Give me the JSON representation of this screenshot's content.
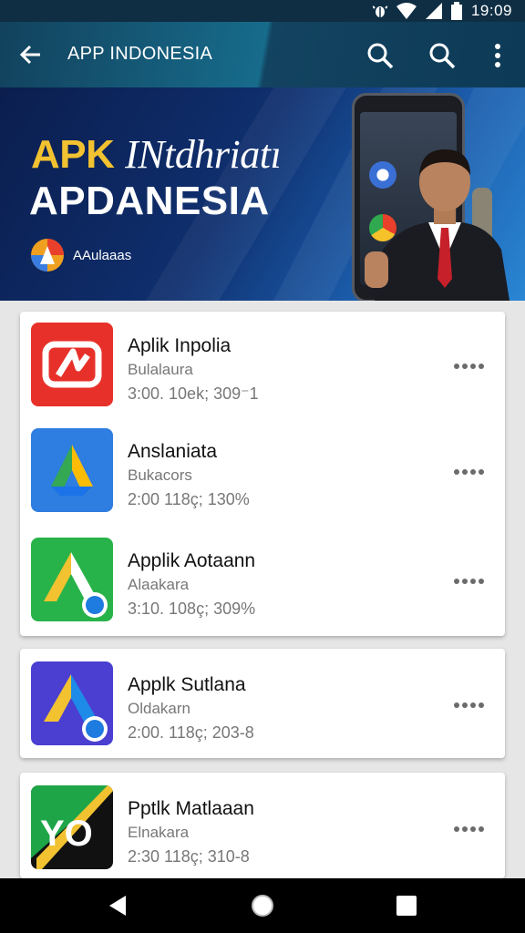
{
  "status_bar": {
    "time": "19:09"
  },
  "app_bar": {
    "title": "APP INDONESIA",
    "back_icon": "arrow-left-icon",
    "search_icon": "search-icon",
    "more_icon": "more-vert-icon"
  },
  "banner": {
    "line1_accent": "APK",
    "line1_rest": "INtdhriatı",
    "line2": "APDANESIA",
    "logo_text": "AAulaaas"
  },
  "apps": [
    {
      "name": "Aplik Inpolia",
      "subtitle": "Bulalaura",
      "meta": "3:00. 10ek; 309⁻1",
      "icon_color": "#e8302a"
    },
    {
      "name": "Anslaniata",
      "subtitle": "Bukacors",
      "meta": "2:00 118ç; 130%",
      "icon_color": "#2e7de0"
    },
    {
      "name": "Applik Aotaann",
      "subtitle": "Alaakara",
      "meta": "3:10. 108ç; 309%",
      "icon_color": "#28b34a"
    },
    {
      "name": "Applk Sutlana",
      "subtitle": "Oldakarn",
      "meta": "2:00. 118ç; 203-8",
      "icon_color": "#4a3fd0"
    },
    {
      "name": "Pptlk Matlaaan",
      "subtitle": "Elnakara",
      "meta": "2:30 118ç; 310-8",
      "icon_color": "#1ea548"
    }
  ],
  "nav_bar": {
    "back_icon": "triangle-back-icon",
    "home_icon": "circle-home-icon",
    "recent_icon": "square-recent-icon"
  }
}
